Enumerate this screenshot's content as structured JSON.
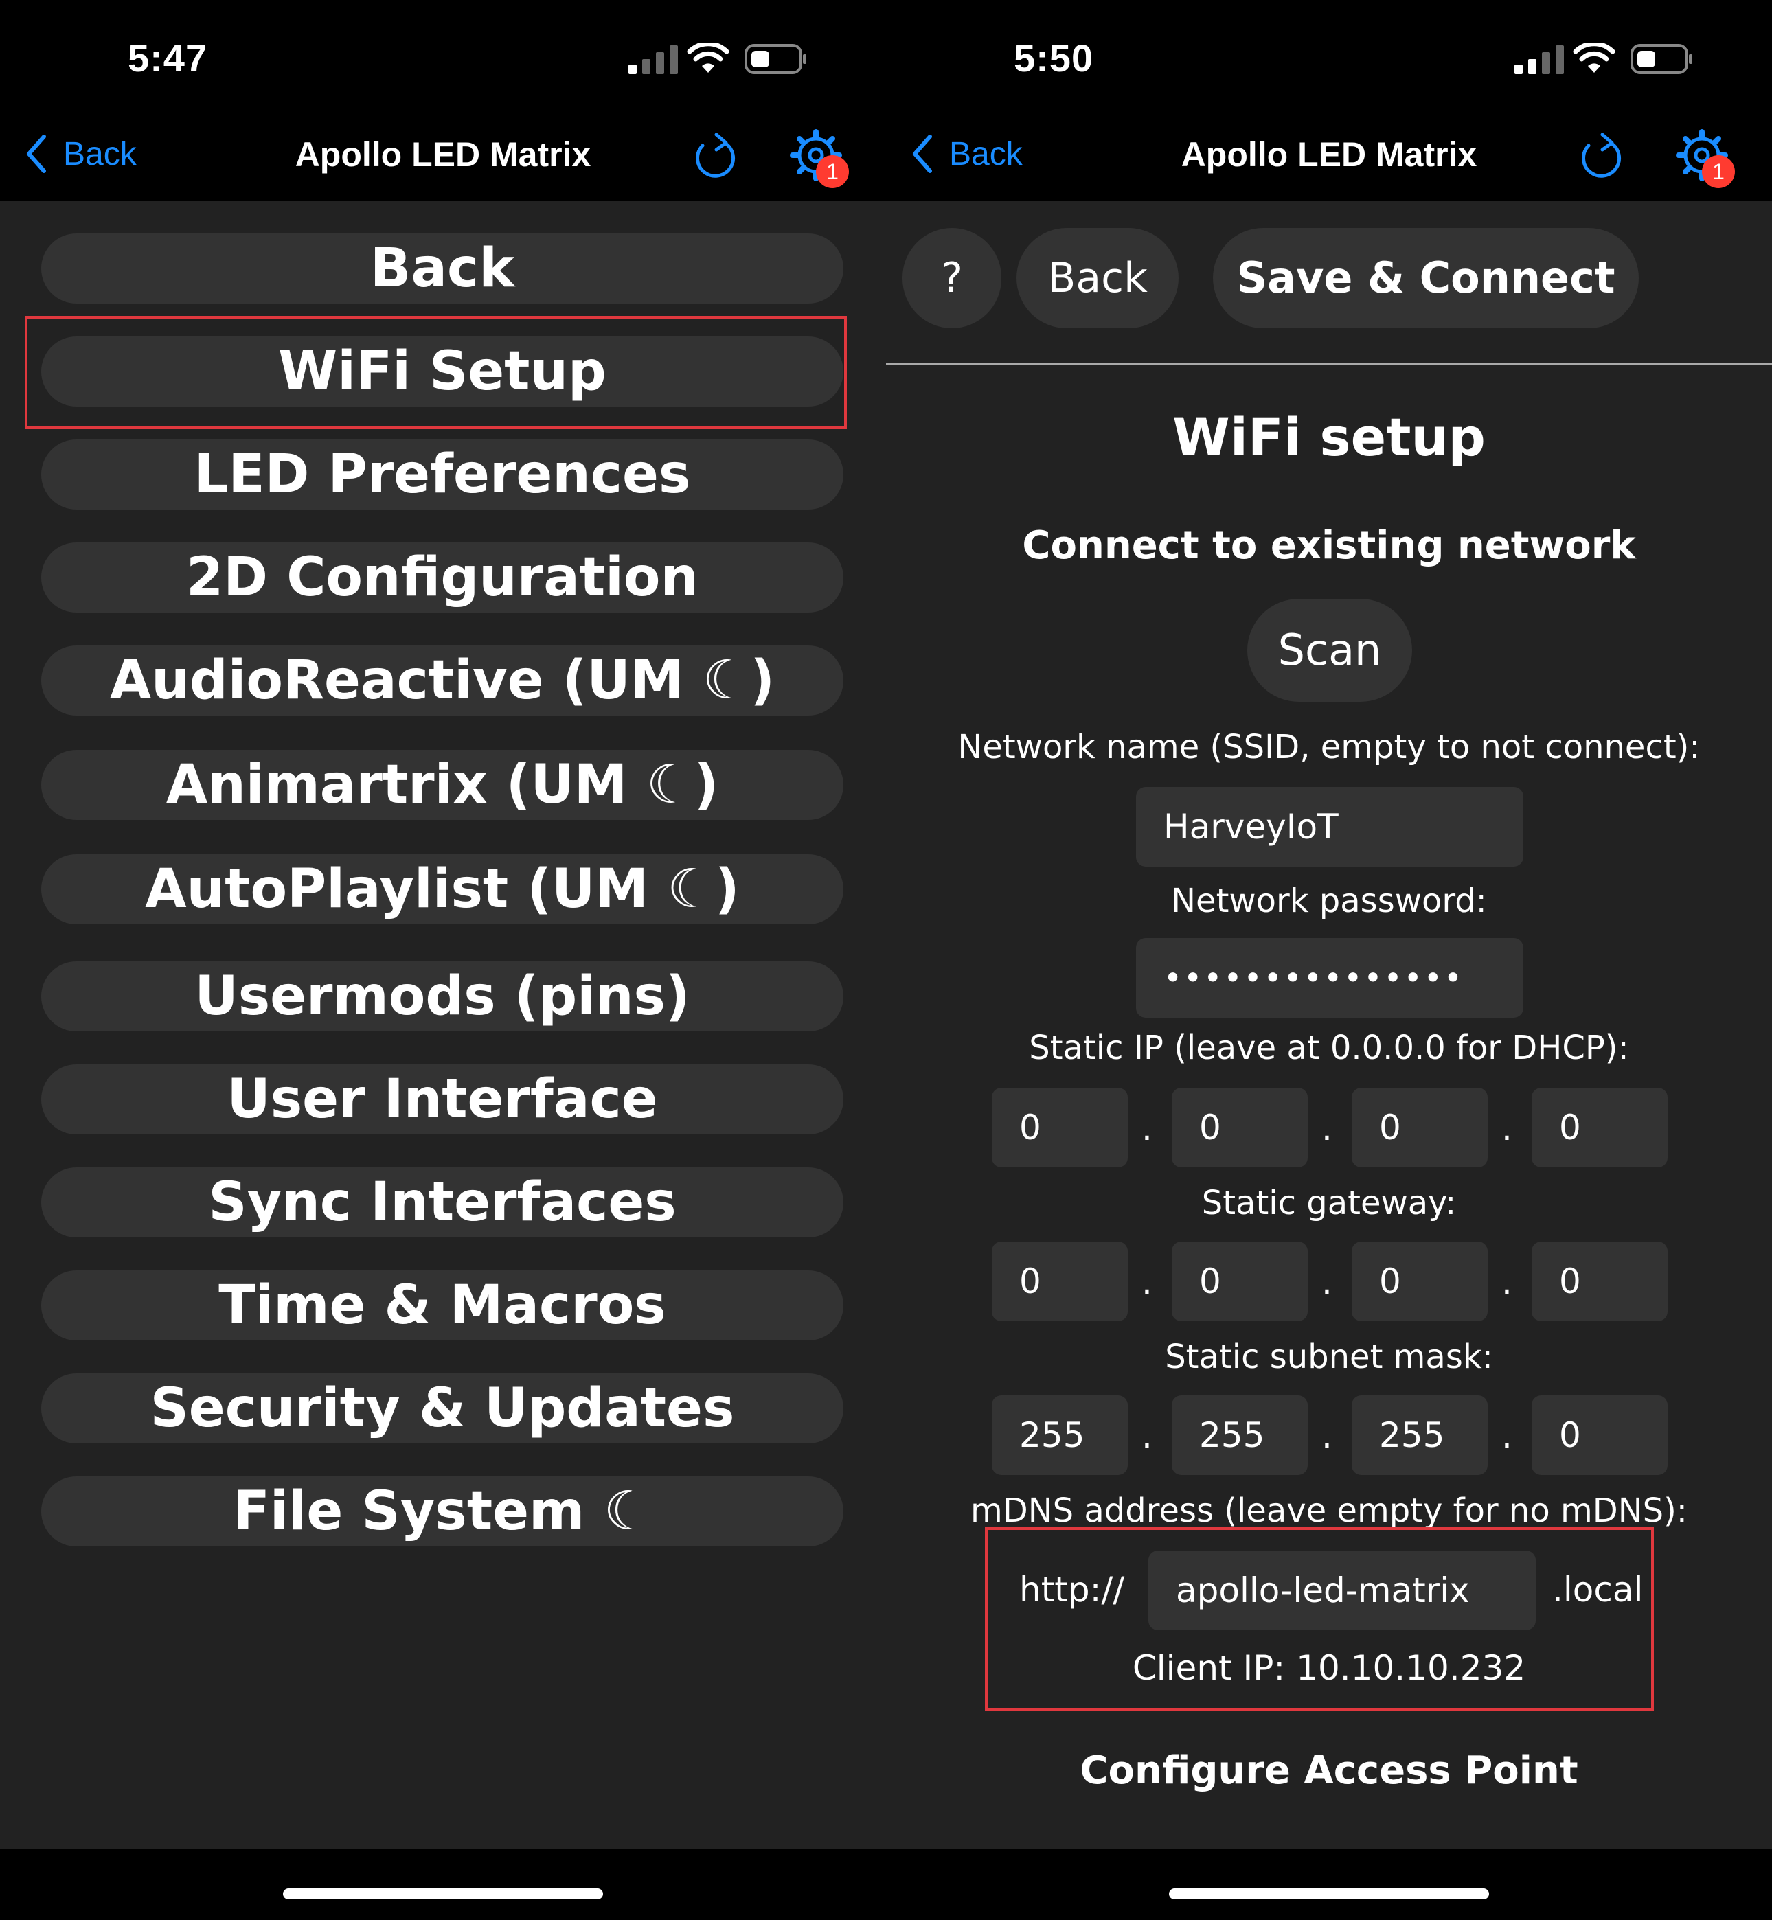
{
  "left": {
    "status": {
      "time": "5:47"
    },
    "nav": {
      "back_label": "Back",
      "title": "Apollo LED Matrix",
      "badge_count": "1"
    },
    "menu": [
      "Back",
      "WiFi Setup",
      "LED Preferences",
      "2D Configuration",
      "AudioReactive (UM ☾)",
      "Animartrix (UM ☾)",
      "AutoPlaylist (UM ☾)",
      "Usermods (pins)",
      "User Interface",
      "Sync Interfaces",
      "Time & Macros",
      "Security & Updates",
      "File System ☾"
    ]
  },
  "right": {
    "status": {
      "time": "5:50"
    },
    "nav": {
      "back_label": "Back",
      "title": "Apollo LED Matrix",
      "badge_count": "1"
    },
    "toolbar": {
      "help_label": "?",
      "back_label": "Back",
      "save_label": "Save & Connect"
    },
    "heading": "WiFi setup",
    "subheading": "Connect to existing network",
    "scan_label": "Scan",
    "ssid": {
      "label": "Network name (SSID, empty to not connect):",
      "value": "HarveyIoT"
    },
    "password": {
      "label": "Network password:",
      "value": "•••••••••••••••"
    },
    "static_ip": {
      "label": "Static IP (leave at 0.0.0.0 for DHCP):",
      "octets": [
        "0",
        "0",
        "0",
        "0"
      ]
    },
    "gateway": {
      "label": "Static gateway:",
      "octets": [
        "0",
        "0",
        "0",
        "0"
      ]
    },
    "subnet": {
      "label": "Static subnet mask:",
      "octets": [
        "255",
        "255",
        "255",
        "0"
      ]
    },
    "mdns": {
      "label": "mDNS address (leave empty for no mDNS):",
      "prefix": "http://",
      "value": "apollo-led-matrix",
      "suffix": ".local"
    },
    "client_ip": "Client IP: 10.10.10.232",
    "ap_heading": "Configure Access Point"
  },
  "colors": {
    "accent": "#1a8cff",
    "badge": "#ff3b30",
    "highlight": "#e0383e",
    "panel": "#222222",
    "button": "#333333"
  }
}
